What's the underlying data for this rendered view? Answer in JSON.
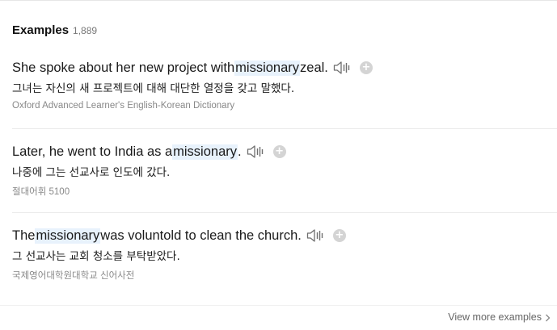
{
  "header": {
    "title": "Examples",
    "count": "1,889"
  },
  "examples": [
    {
      "en_before": "She spoke about her new project with ",
      "en_highlight": "missionary",
      "en_after": " zeal.",
      "ko": "그녀는 자신의 새 프로젝트에 대해 대단한 열정을 갖고 말했다.",
      "source": "Oxford Advanced Learner's English-Korean Dictionary"
    },
    {
      "en_before": "Later, he went to India as a ",
      "en_highlight": "missionary",
      "en_after": ".",
      "ko": "나중에 그는 선교사로 인도에 갔다.",
      "source": "절대어휘 5100"
    },
    {
      "en_before": "The ",
      "en_highlight": "missionary",
      "en_after": " was voluntold to clean the church.",
      "ko": "그 선교사는 교회 청소를 부탁받았다.",
      "source": "국제영어대학원대학교 신어사전"
    }
  ],
  "icons": {
    "listen": "speaker-icon",
    "add": "plus-circle-icon",
    "more": "chevron-right-icon"
  },
  "colors": {
    "highlight": "#e8f2fc",
    "text": "#1a1a1a",
    "muted": "#888888",
    "icon": "#6f6f6f",
    "plus_bg": "#d4d4d4"
  },
  "footer": {
    "view_more": "View more examples"
  }
}
